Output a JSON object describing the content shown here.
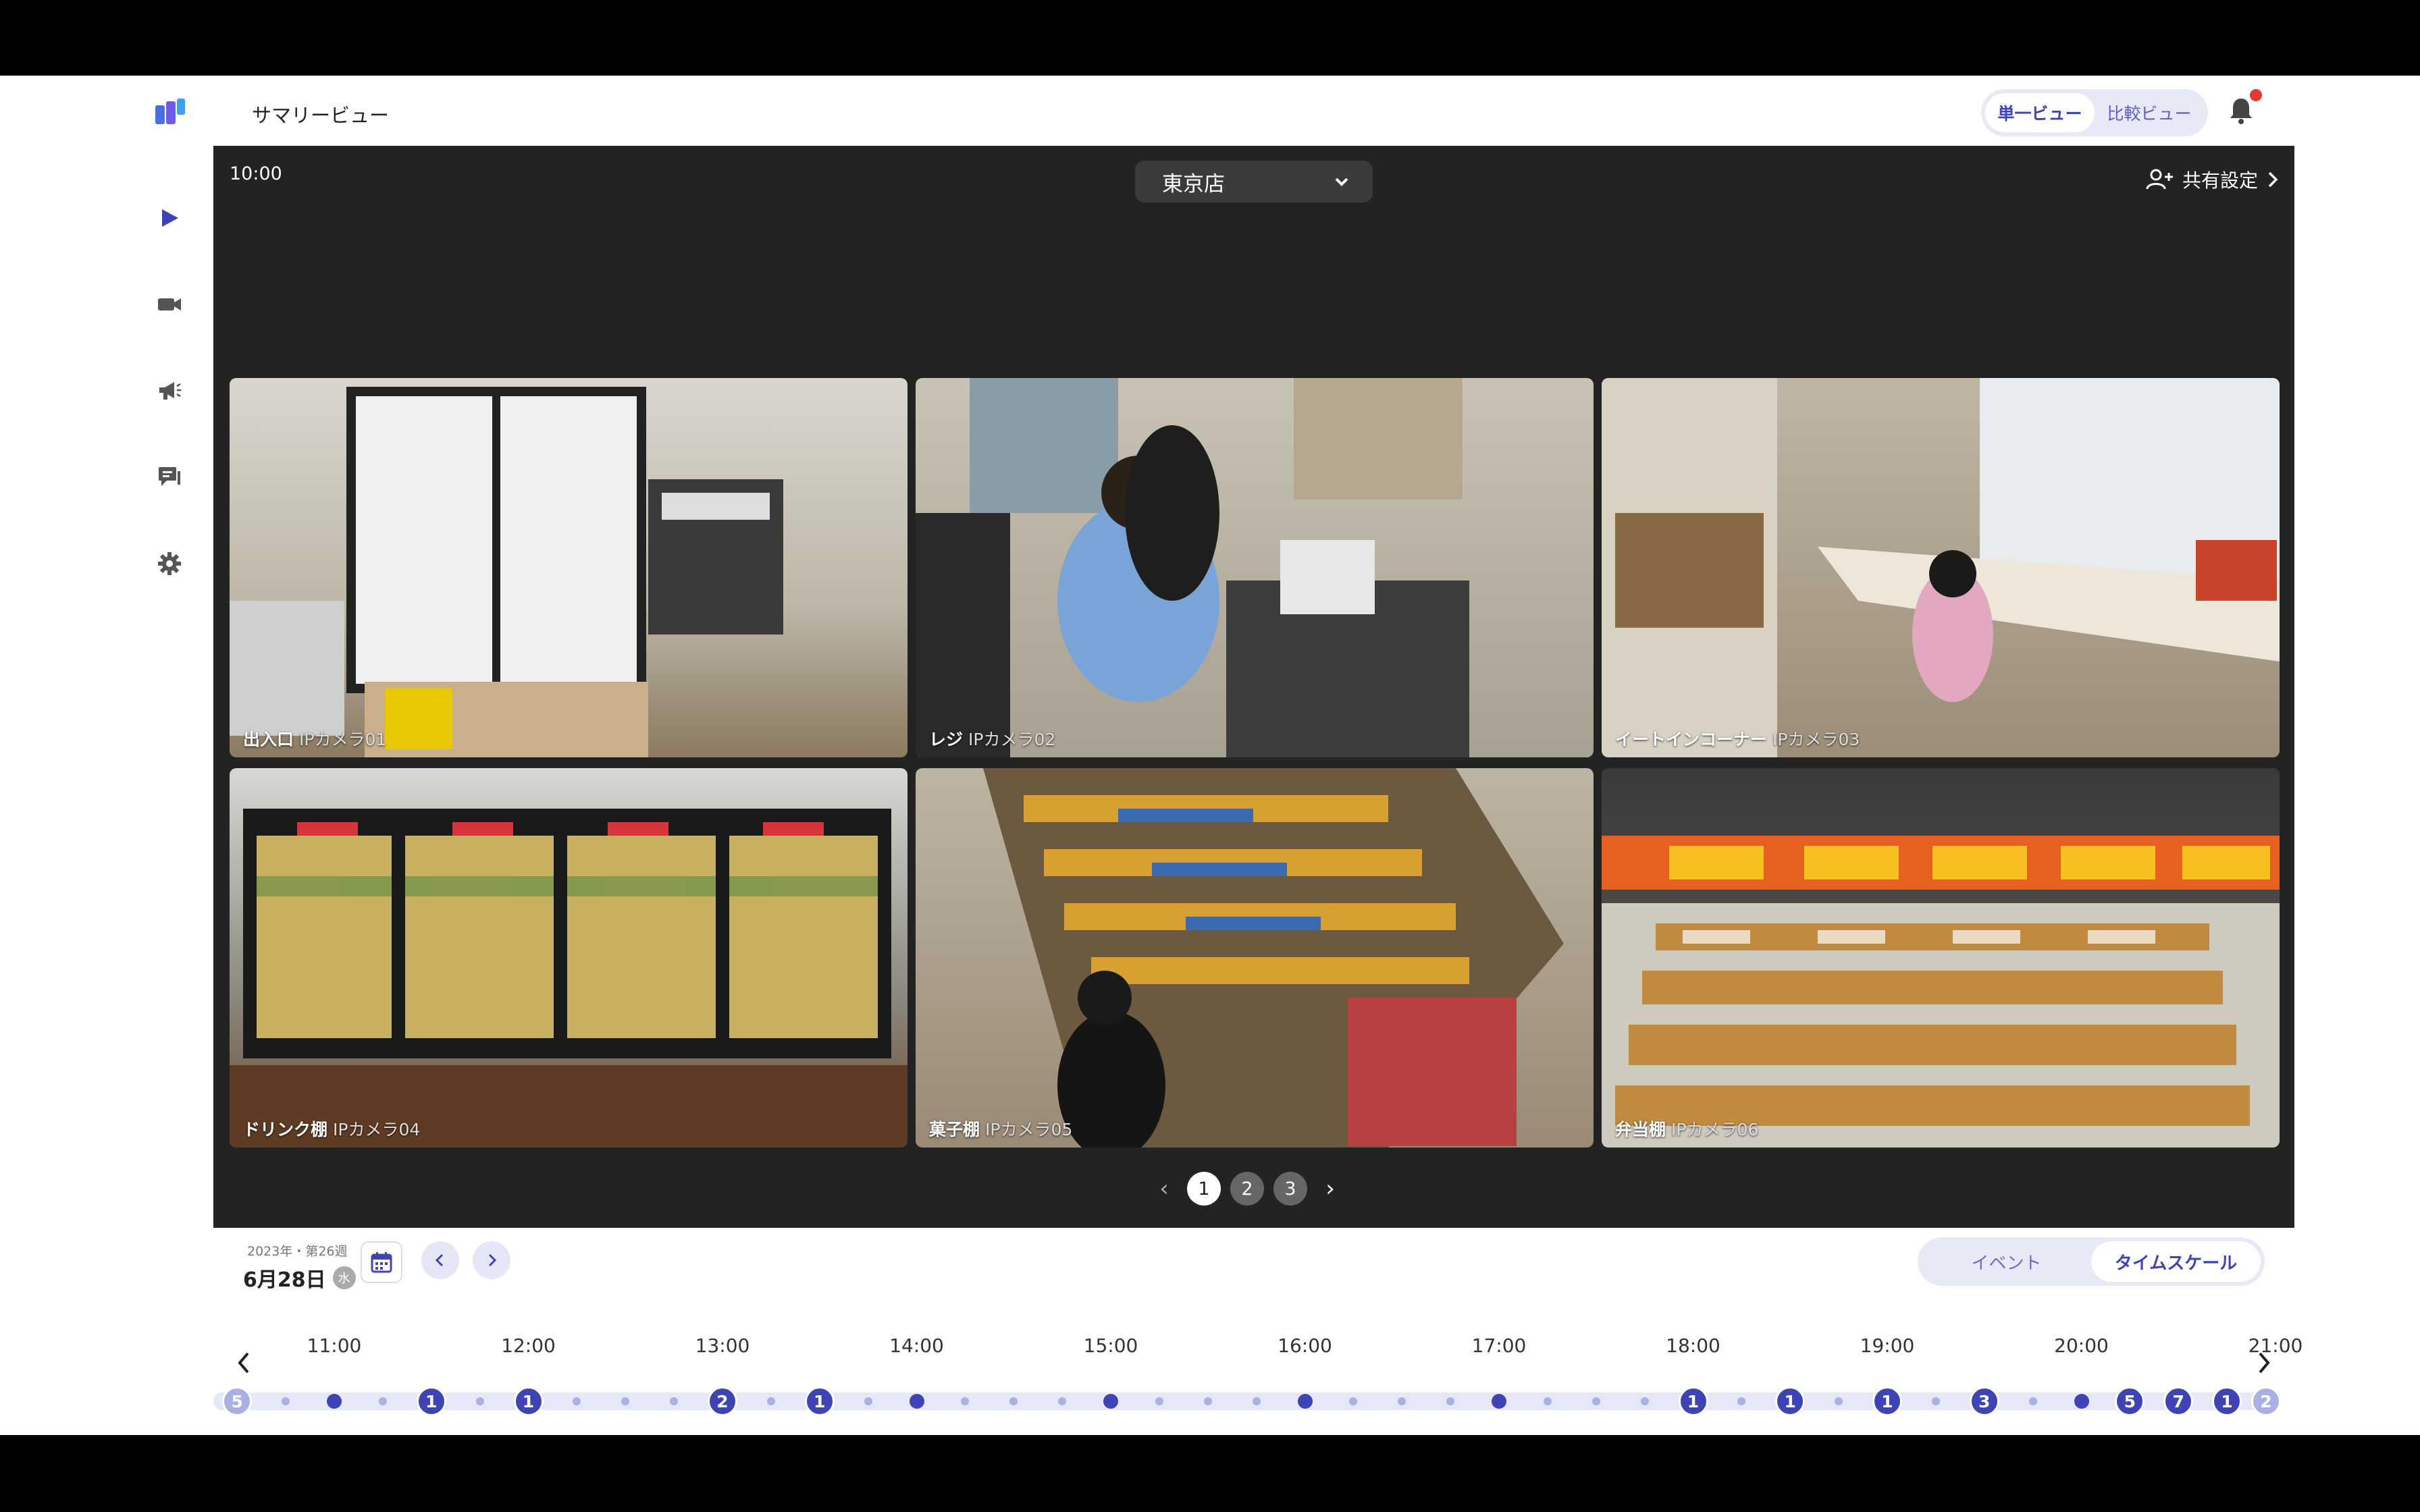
{
  "header": {
    "title": "サマリービュー",
    "view_options": [
      "単一ビュー",
      "比較ビュー"
    ],
    "active_view": "単一ビュー"
  },
  "sidebar": {
    "items": [
      {
        "icon": "play-icon",
        "active": true
      },
      {
        "icon": "camera-icon"
      },
      {
        "icon": "megaphone-icon"
      },
      {
        "icon": "chat-icon"
      },
      {
        "icon": "gear-icon"
      }
    ]
  },
  "panel": {
    "time": "10:00",
    "store": "東京店",
    "share_label": "共有設定"
  },
  "cameras": [
    {
      "name": "出入口",
      "id": "IPカメラ01"
    },
    {
      "name": "レジ",
      "id": "IPカメラ02"
    },
    {
      "name": "イートインコーナー",
      "id": "IPカメラ03"
    },
    {
      "name": "ドリンク棚",
      "id": "IPカメラ04"
    },
    {
      "name": "菓子棚",
      "id": "IPカメラ05"
    },
    {
      "name": "弁当棚",
      "id": "IPカメラ06"
    }
  ],
  "pagination": {
    "pages": [
      "1",
      "2",
      "3"
    ],
    "current": "1"
  },
  "bottom": {
    "week": "2023年・第26週",
    "date": "6月28日",
    "weekday": "水",
    "modes": [
      "イベント",
      "タイムスケール"
    ],
    "active_mode": "タイムスケール"
  },
  "timeline": {
    "hours": [
      "11:00",
      "12:00",
      "13:00",
      "14:00",
      "15:00",
      "16:00",
      "17:00",
      "18:00",
      "19:00",
      "20:00",
      "21:00"
    ],
    "events": [
      {
        "time": "10:30",
        "count": 5
      },
      {
        "time": "11:00",
        "count": 0
      },
      {
        "time": "11:30",
        "count": 1
      },
      {
        "time": "12:00",
        "count": 1
      },
      {
        "time": "13:00",
        "count": 2
      },
      {
        "time": "13:30",
        "count": 1
      },
      {
        "time": "14:00",
        "count": 0
      },
      {
        "time": "15:00",
        "count": 0
      },
      {
        "time": "16:00",
        "count": 0
      },
      {
        "time": "17:00",
        "count": 0
      },
      {
        "time": "18:00",
        "count": 1
      },
      {
        "time": "18:30",
        "count": 1
      },
      {
        "time": "19:00",
        "count": 1
      },
      {
        "time": "19:30",
        "count": 3
      },
      {
        "time": "20:00",
        "count": 0
      },
      {
        "time": "20:15",
        "count": 5
      },
      {
        "time": "20:30",
        "count": 7
      },
      {
        "time": "20:45",
        "count": 1
      },
      {
        "time": "21:00",
        "count": 2
      }
    ]
  },
  "colors": {
    "accent": "#3e44b6",
    "panel": "#232323",
    "notification": "#e53935"
  }
}
